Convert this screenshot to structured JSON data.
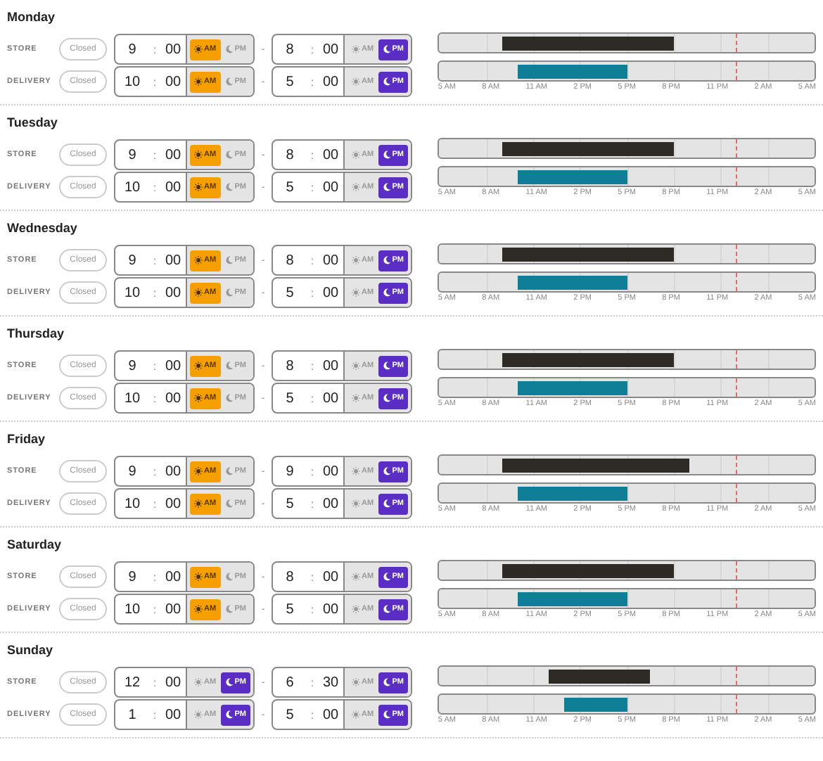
{
  "days": [
    {
      "name": "Monday",
      "rows": [
        {
          "label": "STORE",
          "closed_label": "Closed",
          "closed": false,
          "color": "#2e2a26",
          "open": {
            "hour": "9",
            "colon": ":",
            "minute": "00",
            "periods": [
              {
                "label": "AM",
                "selected": true
              },
              {
                "label": "PM",
                "selected": false
              }
            ]
          },
          "dash": "-",
          "close": {
            "hour": "8",
            "colon": ":",
            "minute": "00",
            "periods": [
              {
                "label": "AM",
                "selected": false
              },
              {
                "label": "PM",
                "selected": true
              }
            ]
          }
        },
        {
          "label": "DELIVERY",
          "closed_label": "Closed",
          "closed": false,
          "color": "#0e7f96",
          "open": {
            "hour": "10",
            "colon": ":",
            "minute": "00",
            "periods": [
              {
                "label": "AM",
                "selected": true
              },
              {
                "label": "PM",
                "selected": false
              }
            ]
          },
          "dash": "-",
          "close": {
            "hour": "5",
            "colon": ":",
            "minute": "00",
            "periods": [
              {
                "label": "AM",
                "selected": false
              },
              {
                "label": "PM",
                "selected": true
              }
            ]
          }
        }
      ],
      "axis_labels": [
        "5 AM",
        "8 AM",
        "11 AM",
        "2 PM",
        "5 PM",
        "8 PM",
        "11 PM",
        "2 AM",
        "5 AM"
      ]
    },
    {
      "name": "Tuesday",
      "rows": [
        {
          "label": "STORE",
          "closed_label": "Closed",
          "closed": false,
          "color": "#2e2a26",
          "open": {
            "hour": "9",
            "colon": ":",
            "minute": "00",
            "periods": [
              {
                "label": "AM",
                "selected": true
              },
              {
                "label": "PM",
                "selected": false
              }
            ]
          },
          "dash": "-",
          "close": {
            "hour": "8",
            "colon": ":",
            "minute": "00",
            "periods": [
              {
                "label": "AM",
                "selected": false
              },
              {
                "label": "PM",
                "selected": true
              }
            ]
          }
        },
        {
          "label": "DELIVERY",
          "closed_label": "Closed",
          "closed": false,
          "color": "#0e7f96",
          "open": {
            "hour": "10",
            "colon": ":",
            "minute": "00",
            "periods": [
              {
                "label": "AM",
                "selected": true
              },
              {
                "label": "PM",
                "selected": false
              }
            ]
          },
          "dash": "-",
          "close": {
            "hour": "5",
            "colon": ":",
            "minute": "00",
            "periods": [
              {
                "label": "AM",
                "selected": false
              },
              {
                "label": "PM",
                "selected": true
              }
            ]
          }
        }
      ],
      "axis_labels": [
        "5 AM",
        "8 AM",
        "11 AM",
        "2 PM",
        "5 PM",
        "8 PM",
        "11 PM",
        "2 AM",
        "5 AM"
      ]
    },
    {
      "name": "Wednesday",
      "rows": [
        {
          "label": "STORE",
          "closed_label": "Closed",
          "closed": false,
          "color": "#2e2a26",
          "open": {
            "hour": "9",
            "colon": ":",
            "minute": "00",
            "periods": [
              {
                "label": "AM",
                "selected": true
              },
              {
                "label": "PM",
                "selected": false
              }
            ]
          },
          "dash": "-",
          "close": {
            "hour": "8",
            "colon": ":",
            "minute": "00",
            "periods": [
              {
                "label": "AM",
                "selected": false
              },
              {
                "label": "PM",
                "selected": true
              }
            ]
          }
        },
        {
          "label": "DELIVERY",
          "closed_label": "Closed",
          "closed": false,
          "color": "#0e7f96",
          "open": {
            "hour": "10",
            "colon": ":",
            "minute": "00",
            "periods": [
              {
                "label": "AM",
                "selected": true
              },
              {
                "label": "PM",
                "selected": false
              }
            ]
          },
          "dash": "-",
          "close": {
            "hour": "5",
            "colon": ":",
            "minute": "00",
            "periods": [
              {
                "label": "AM",
                "selected": false
              },
              {
                "label": "PM",
                "selected": true
              }
            ]
          }
        }
      ],
      "axis_labels": [
        "5 AM",
        "8 AM",
        "11 AM",
        "2 PM",
        "5 PM",
        "8 PM",
        "11 PM",
        "2 AM",
        "5 AM"
      ]
    },
    {
      "name": "Thursday",
      "rows": [
        {
          "label": "STORE",
          "closed_label": "Closed",
          "closed": false,
          "color": "#2e2a26",
          "open": {
            "hour": "9",
            "colon": ":",
            "minute": "00",
            "periods": [
              {
                "label": "AM",
                "selected": true
              },
              {
                "label": "PM",
                "selected": false
              }
            ]
          },
          "dash": "-",
          "close": {
            "hour": "8",
            "colon": ":",
            "minute": "00",
            "periods": [
              {
                "label": "AM",
                "selected": false
              },
              {
                "label": "PM",
                "selected": true
              }
            ]
          }
        },
        {
          "label": "DELIVERY",
          "closed_label": "Closed",
          "closed": false,
          "color": "#0e7f96",
          "open": {
            "hour": "10",
            "colon": ":",
            "minute": "00",
            "periods": [
              {
                "label": "AM",
                "selected": true
              },
              {
                "label": "PM",
                "selected": false
              }
            ]
          },
          "dash": "-",
          "close": {
            "hour": "5",
            "colon": ":",
            "minute": "00",
            "periods": [
              {
                "label": "AM",
                "selected": false
              },
              {
                "label": "PM",
                "selected": true
              }
            ]
          }
        }
      ],
      "axis_labels": [
        "5 AM",
        "8 AM",
        "11 AM",
        "2 PM",
        "5 PM",
        "8 PM",
        "11 PM",
        "2 AM",
        "5 AM"
      ]
    },
    {
      "name": "Friday",
      "rows": [
        {
          "label": "STORE",
          "closed_label": "Closed",
          "closed": false,
          "color": "#2e2a26",
          "open": {
            "hour": "9",
            "colon": ":",
            "minute": "00",
            "periods": [
              {
                "label": "AM",
                "selected": true
              },
              {
                "label": "PM",
                "selected": false
              }
            ]
          },
          "dash": "-",
          "close": {
            "hour": "9",
            "colon": ":",
            "minute": "00",
            "periods": [
              {
                "label": "AM",
                "selected": false
              },
              {
                "label": "PM",
                "selected": true
              }
            ]
          }
        },
        {
          "label": "DELIVERY",
          "closed_label": "Closed",
          "closed": false,
          "color": "#0e7f96",
          "open": {
            "hour": "10",
            "colon": ":",
            "minute": "00",
            "periods": [
              {
                "label": "AM",
                "selected": true
              },
              {
                "label": "PM",
                "selected": false
              }
            ]
          },
          "dash": "-",
          "close": {
            "hour": "5",
            "colon": ":",
            "minute": "00",
            "periods": [
              {
                "label": "AM",
                "selected": false
              },
              {
                "label": "PM",
                "selected": true
              }
            ]
          }
        }
      ],
      "axis_labels": [
        "5 AM",
        "8 AM",
        "11 AM",
        "2 PM",
        "5 PM",
        "8 PM",
        "11 PM",
        "2 AM",
        "5 AM"
      ]
    },
    {
      "name": "Saturday",
      "rows": [
        {
          "label": "STORE",
          "closed_label": "Closed",
          "closed": false,
          "color": "#2e2a26",
          "open": {
            "hour": "9",
            "colon": ":",
            "minute": "00",
            "periods": [
              {
                "label": "AM",
                "selected": true
              },
              {
                "label": "PM",
                "selected": false
              }
            ]
          },
          "dash": "-",
          "close": {
            "hour": "8",
            "colon": ":",
            "minute": "00",
            "periods": [
              {
                "label": "AM",
                "selected": false
              },
              {
                "label": "PM",
                "selected": true
              }
            ]
          }
        },
        {
          "label": "DELIVERY",
          "closed_label": "Closed",
          "closed": false,
          "color": "#0e7f96",
          "open": {
            "hour": "10",
            "colon": ":",
            "minute": "00",
            "periods": [
              {
                "label": "AM",
                "selected": true
              },
              {
                "label": "PM",
                "selected": false
              }
            ]
          },
          "dash": "-",
          "close": {
            "hour": "5",
            "colon": ":",
            "minute": "00",
            "periods": [
              {
                "label": "AM",
                "selected": false
              },
              {
                "label": "PM",
                "selected": true
              }
            ]
          }
        }
      ],
      "axis_labels": [
        "5 AM",
        "8 AM",
        "11 AM",
        "2 PM",
        "5 PM",
        "8 PM",
        "11 PM",
        "2 AM",
        "5 AM"
      ]
    },
    {
      "name": "Sunday",
      "rows": [
        {
          "label": "STORE",
          "closed_label": "Closed",
          "closed": false,
          "color": "#2e2a26",
          "open": {
            "hour": "12",
            "colon": ":",
            "minute": "00",
            "periods": [
              {
                "label": "AM",
                "selected": false
              },
              {
                "label": "PM",
                "selected": true
              }
            ]
          },
          "dash": "-",
          "close": {
            "hour": "6",
            "colon": ":",
            "minute": "30",
            "periods": [
              {
                "label": "AM",
                "selected": false
              },
              {
                "label": "PM",
                "selected": true
              }
            ]
          }
        },
        {
          "label": "DELIVERY",
          "closed_label": "Closed",
          "closed": false,
          "color": "#0e7f96",
          "open": {
            "hour": "1",
            "colon": ":",
            "minute": "00",
            "periods": [
              {
                "label": "AM",
                "selected": false
              },
              {
                "label": "PM",
                "selected": true
              }
            ]
          },
          "dash": "-",
          "close": {
            "hour": "5",
            "colon": ":",
            "minute": "00",
            "periods": [
              {
                "label": "AM",
                "selected": false
              },
              {
                "label": "PM",
                "selected": true
              }
            ]
          }
        }
      ],
      "axis_labels": [
        "5 AM",
        "8 AM",
        "11 AM",
        "2 PM",
        "5 PM",
        "8 PM",
        "11 PM",
        "2 AM",
        "5 AM"
      ]
    }
  ]
}
